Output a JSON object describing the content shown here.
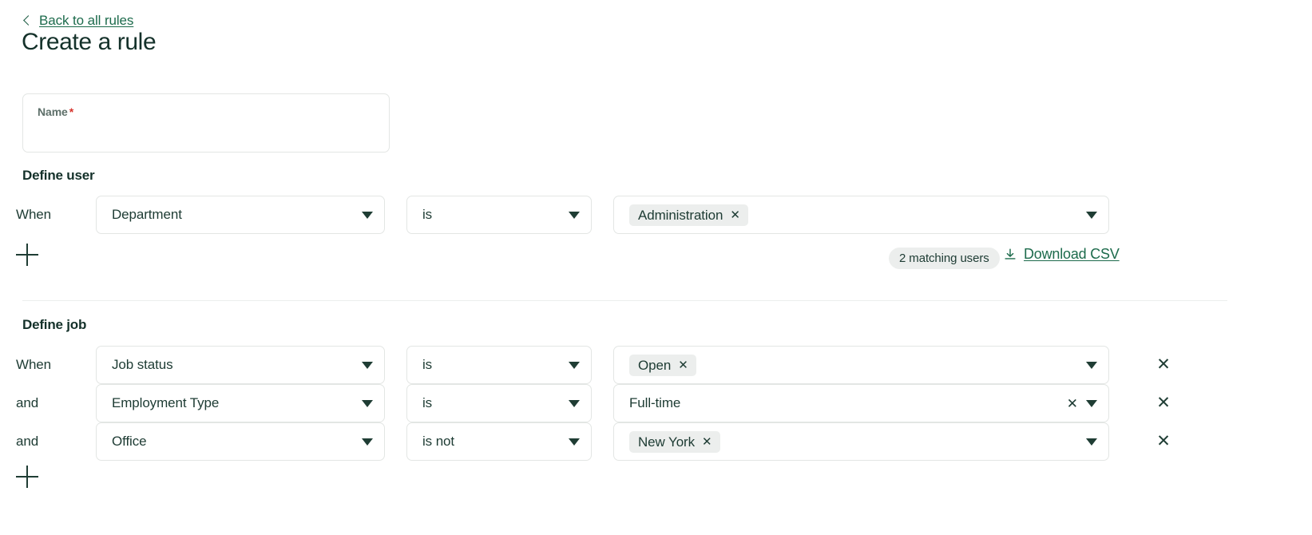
{
  "header": {
    "back_link": "Back to all rules",
    "title": "Create a rule"
  },
  "name_field": {
    "label": "Name",
    "required_mark": "*",
    "value": "",
    "placeholder": ""
  },
  "define_user": {
    "heading": "Define user",
    "rows": [
      {
        "conjunction": "When",
        "field": "Department",
        "operator": "is",
        "value_chips": [
          "Administration"
        ],
        "chip_remove_glyph": "✕"
      }
    ],
    "add_label": "+",
    "matching_badge": "2 matching users",
    "download_label": "Download CSV"
  },
  "define_job": {
    "heading": "Define job",
    "rows": [
      {
        "conjunction": "When",
        "field": "Job status",
        "operator": "is",
        "value_chips": [
          "Open"
        ],
        "plain_value": "",
        "has_clear_x": false,
        "chip_remove_glyph": "✕",
        "remove_row_glyph": "✕"
      },
      {
        "conjunction": "and",
        "field": "Employment Type",
        "operator": "is",
        "value_chips": [],
        "plain_value": "Full-time",
        "has_clear_x": true,
        "clear_glyph": "✕",
        "remove_row_glyph": "✕"
      },
      {
        "conjunction": "and",
        "field": "Office",
        "operator": "is not",
        "value_chips": [
          "New York"
        ],
        "plain_value": "",
        "has_clear_x": false,
        "chip_remove_glyph": "✕",
        "remove_row_glyph": "✕"
      }
    ],
    "add_label": "+"
  },
  "colors": {
    "accent_green": "#1d6b4c",
    "text_dark": "#14312a",
    "chip_bg": "#eceeed",
    "border": "#e3e6e4",
    "required_red": "#d7342d"
  }
}
